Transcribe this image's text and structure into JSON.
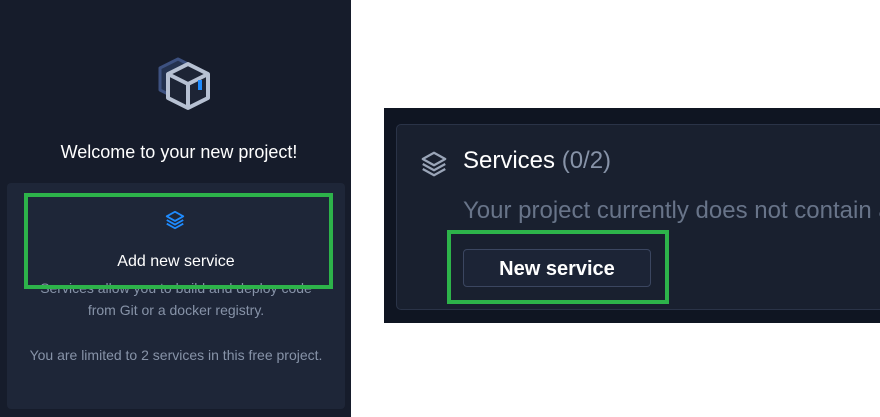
{
  "welcome": {
    "title": "Welcome to your new project!",
    "icon": "package-box-icon"
  },
  "add_service_card": {
    "icon": "layers-icon",
    "title": "Add new service",
    "description": "Services allow you to build and deploy code from Git or a docker registry.",
    "limit_note": "You are limited to 2 services in this free project."
  },
  "services_panel": {
    "icon": "layers-icon",
    "title": "Services",
    "count": "(0/2)",
    "empty_message": "Your project currently does not contain any services.",
    "new_button_label": "New service"
  },
  "colors": {
    "highlight": "#2db34a",
    "accent_blue": "#1e8bff",
    "panel_bg": "#161c2b"
  }
}
